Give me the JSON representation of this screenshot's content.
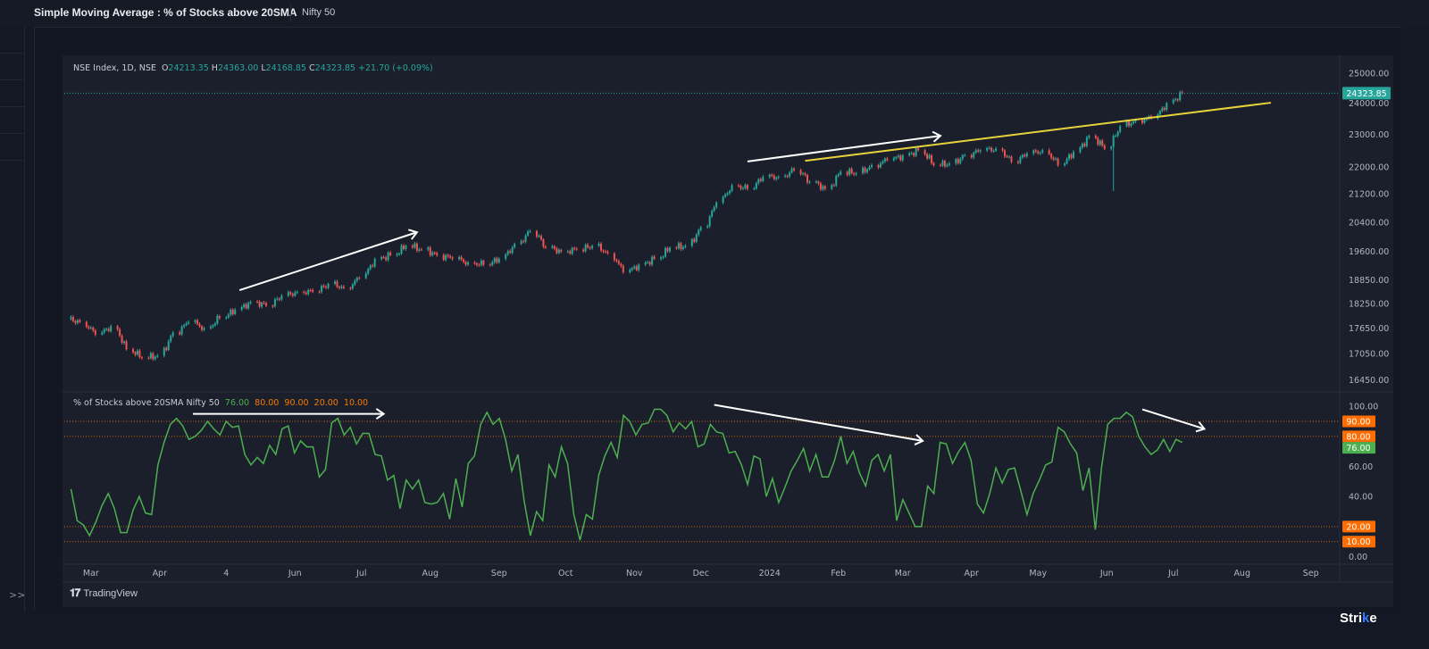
{
  "header": {
    "title": "Simple Moving Average : % of Stocks above 20SMA",
    "symbol": "Nifty 50"
  },
  "sidebar": {
    "expand_icon": "double-chevron-right-icon",
    "expand_label": ">>"
  },
  "main_legend": {
    "symbol": "NSE Index, 1D, NSE",
    "open_label": "O",
    "open": "24213.35",
    "high_label": "H",
    "high": "24363.00",
    "low_label": "L",
    "low": "24168.85",
    "close_label": "C",
    "close": "24323.85",
    "change": "+21.70 (+0.09%)"
  },
  "indicator_legend": {
    "name": "% of Stocks above 20SMA Nifty 50",
    "value": "76.00",
    "l1": "80.00",
    "l2": "90.00",
    "l3": "20.00",
    "l4": "10.00"
  },
  "footer": {
    "brand": "TradingView",
    "logo": "17",
    "watermark": "Strike"
  },
  "colors": {
    "up": "#26a69a",
    "down": "#ef5350",
    "indicator_line": "#4caf50",
    "level": "#f57c00",
    "trendline": "#e6d43a",
    "arrows": "#ffffff",
    "background": "#131722"
  },
  "chart_data": [
    {
      "type": "candlestick",
      "title": "NSE Index, 1D, NSE",
      "scale": "log",
      "ylim": [
        16200,
        25520
      ],
      "xlim": [
        "2023-02-17",
        "2024-09-14"
      ],
      "y_ticks": [
        "25000.00",
        "24000.00",
        "23000.00",
        "22000.00",
        "21200.00",
        "20400.00",
        "19600.00",
        "18850.00",
        "18250.00",
        "17650.00",
        "17050.00",
        "16450.00"
      ],
      "last_price": "24323.85",
      "x_ticks": [
        {
          "date": "2023-03-01",
          "label": "Mar"
        },
        {
          "date": "2023-04-01",
          "label": "Apr"
        },
        {
          "date": "2023-05-01",
          "label": "4"
        },
        {
          "date": "2023-06-01",
          "label": "Jun"
        },
        {
          "date": "2023-07-01",
          "label": "Jul"
        },
        {
          "date": "2023-08-01",
          "label": "Aug"
        },
        {
          "date": "2023-09-01",
          "label": "Sep"
        },
        {
          "date": "2023-10-01",
          "label": "Oct"
        },
        {
          "date": "2023-11-01",
          "label": "Nov"
        },
        {
          "date": "2023-12-01",
          "label": "Dec"
        },
        {
          "date": "2024-01-01",
          "label": "2024"
        },
        {
          "date": "2024-02-01",
          "label": "Feb"
        },
        {
          "date": "2024-03-01",
          "label": "Mar"
        },
        {
          "date": "2024-04-01",
          "label": "Apr"
        },
        {
          "date": "2024-05-01",
          "label": "May"
        },
        {
          "date": "2024-06-01",
          "label": "Jun"
        },
        {
          "date": "2024-07-01",
          "label": "Jul"
        },
        {
          "date": "2024-08-01",
          "label": "Aug"
        },
        {
          "date": "2024-09-01",
          "label": "Sep"
        }
      ],
      "weekly_closes": [
        [
          "2023-02-20",
          17800
        ],
        [
          "2023-02-27",
          17500
        ],
        [
          "2023-03-06",
          17700
        ],
        [
          "2023-03-13",
          17150
        ],
        [
          "2023-03-20",
          16950
        ],
        [
          "2023-03-27",
          17000
        ],
        [
          "2023-04-03",
          17550
        ],
        [
          "2023-04-10",
          17800
        ],
        [
          "2023-04-17",
          17650
        ],
        [
          "2023-04-24",
          17900
        ],
        [
          "2023-05-01",
          18100
        ],
        [
          "2023-05-08",
          18300
        ],
        [
          "2023-05-15",
          18200
        ],
        [
          "2023-05-22",
          18450
        ],
        [
          "2023-05-29",
          18550
        ],
        [
          "2023-06-05",
          18550
        ],
        [
          "2023-06-12",
          18750
        ],
        [
          "2023-06-19",
          18650
        ],
        [
          "2023-06-26",
          18900
        ],
        [
          "2023-07-03",
          19400
        ],
        [
          "2023-07-10",
          19500
        ],
        [
          "2023-07-17",
          19750
        ],
        [
          "2023-07-24",
          19650
        ],
        [
          "2023-07-31",
          19500
        ],
        [
          "2023-08-07",
          19400
        ],
        [
          "2023-08-14",
          19300
        ],
        [
          "2023-08-21",
          19250
        ],
        [
          "2023-08-28",
          19400
        ],
        [
          "2023-09-04",
          19800
        ],
        [
          "2023-09-11",
          20150
        ],
        [
          "2023-09-18",
          19700
        ],
        [
          "2023-09-25",
          19600
        ],
        [
          "2023-10-02",
          19650
        ],
        [
          "2023-10-09",
          19750
        ],
        [
          "2023-10-16",
          19550
        ],
        [
          "2023-10-23",
          19050
        ],
        [
          "2023-10-30",
          19250
        ],
        [
          "2023-11-06",
          19400
        ],
        [
          "2023-11-13",
          19700
        ],
        [
          "2023-11-20",
          19750
        ],
        [
          "2023-11-27",
          20250
        ],
        [
          "2023-12-04",
          20950
        ],
        [
          "2023-12-11",
          21450
        ],
        [
          "2023-12-18",
          21350
        ],
        [
          "2023-12-25",
          21700
        ],
        [
          "2024-01-01",
          21700
        ],
        [
          "2024-01-08",
          21900
        ],
        [
          "2024-01-15",
          21550
        ],
        [
          "2024-01-22",
          21350
        ],
        [
          "2024-01-29",
          21850
        ],
        [
          "2024-02-05",
          21800
        ],
        [
          "2024-02-12",
          22050
        ],
        [
          "2024-02-19",
          22200
        ],
        [
          "2024-02-26",
          22350
        ],
        [
          "2024-03-04",
          22500
        ],
        [
          "2024-03-11",
          22050
        ],
        [
          "2024-03-18",
          22100
        ],
        [
          "2024-03-25",
          22350
        ],
        [
          "2024-04-01",
          22500
        ],
        [
          "2024-04-08",
          22550
        ],
        [
          "2024-04-15",
          22150
        ],
        [
          "2024-04-22",
          22400
        ],
        [
          "2024-04-29",
          22500
        ],
        [
          "2024-05-06",
          22050
        ],
        [
          "2024-05-13",
          22450
        ],
        [
          "2024-05-20",
          22950
        ],
        [
          "2024-05-27",
          22550
        ],
        [
          "2024-06-03",
          23250
        ],
        [
          "2024-06-10",
          23450
        ],
        [
          "2024-06-17",
          23500
        ],
        [
          "2024-06-24",
          24000
        ],
        [
          "2024-07-01",
          24323.85
        ]
      ],
      "spike_low": {
        "date": "2024-06-04",
        "low": 21281
      },
      "trendline": {
        "from": [
          "2024-01-17",
          22180
        ],
        "to": [
          "2024-08-14",
          24010
        ]
      },
      "arrows": [
        {
          "from": [
            "2023-05-07",
            18590
          ],
          "to": [
            "2023-07-26",
            20120
          ]
        },
        {
          "from": [
            "2023-12-22",
            22160
          ],
          "to": [
            "2024-03-18",
            22950
          ]
        }
      ]
    },
    {
      "type": "line",
      "title": "% of Stocks above 20SMA Nifty 50",
      "ylim": [
        -5,
        109
      ],
      "x_range": [
        "2023-02-20",
        "2024-07-05"
      ],
      "y_ticks": [
        "100.00",
        "60.00",
        "40.00",
        "0.00"
      ],
      "levels": [
        90,
        80,
        20,
        10
      ],
      "level_labels": [
        "90.00",
        "80.00",
        "20.00",
        "10.00"
      ],
      "last_value": "76.00",
      "values": [
        45,
        24,
        21,
        14,
        23,
        34,
        42,
        32,
        16,
        16,
        31,
        40,
        29,
        28,
        61,
        76,
        88,
        92,
        87,
        78,
        80,
        84,
        90,
        85,
        81,
        90,
        86,
        87,
        68,
        61,
        66,
        62,
        74,
        68,
        85,
        87,
        69,
        77,
        73,
        73,
        53,
        58,
        89,
        92,
        81,
        86,
        75,
        82,
        82,
        68,
        67,
        51,
        54,
        32,
        51,
        45,
        51,
        36,
        35,
        36,
        42,
        25,
        52,
        33,
        62,
        67,
        88,
        96,
        88,
        92,
        78,
        57,
        68,
        37,
        14,
        30,
        24,
        61,
        53,
        73,
        62,
        28,
        11,
        28,
        25,
        54,
        67,
        76,
        66,
        94,
        90,
        81,
        88,
        89,
        98,
        98,
        94,
        83,
        89,
        85,
        90,
        73,
        75,
        88,
        83,
        82,
        69,
        70,
        61,
        48,
        67,
        65,
        40,
        52,
        36,
        46,
        57,
        64,
        72,
        57,
        68,
        53,
        53,
        64,
        80,
        62,
        70,
        56,
        47,
        64,
        68,
        57,
        68,
        24,
        38,
        29,
        20,
        20,
        47,
        42,
        76,
        75,
        62,
        70,
        76,
        64,
        35,
        29,
        42,
        59,
        49,
        58,
        59,
        44,
        28,
        42,
        51,
        61,
        63,
        86,
        83,
        75,
        69,
        44,
        59,
        18,
        59,
        88,
        92,
        92,
        96,
        93,
        80,
        73,
        68,
        71,
        78,
        70,
        78,
        76
      ],
      "arrows": [
        {
          "from": [
            "2023-04-16",
            95
          ],
          "to": [
            "2023-07-11",
            95
          ]
        },
        {
          "from": [
            "2023-12-07",
            101
          ],
          "to": [
            "2024-03-10",
            77
          ]
        },
        {
          "from": [
            "2024-06-17",
            98
          ],
          "to": [
            "2024-07-15",
            85
          ]
        }
      ]
    }
  ]
}
